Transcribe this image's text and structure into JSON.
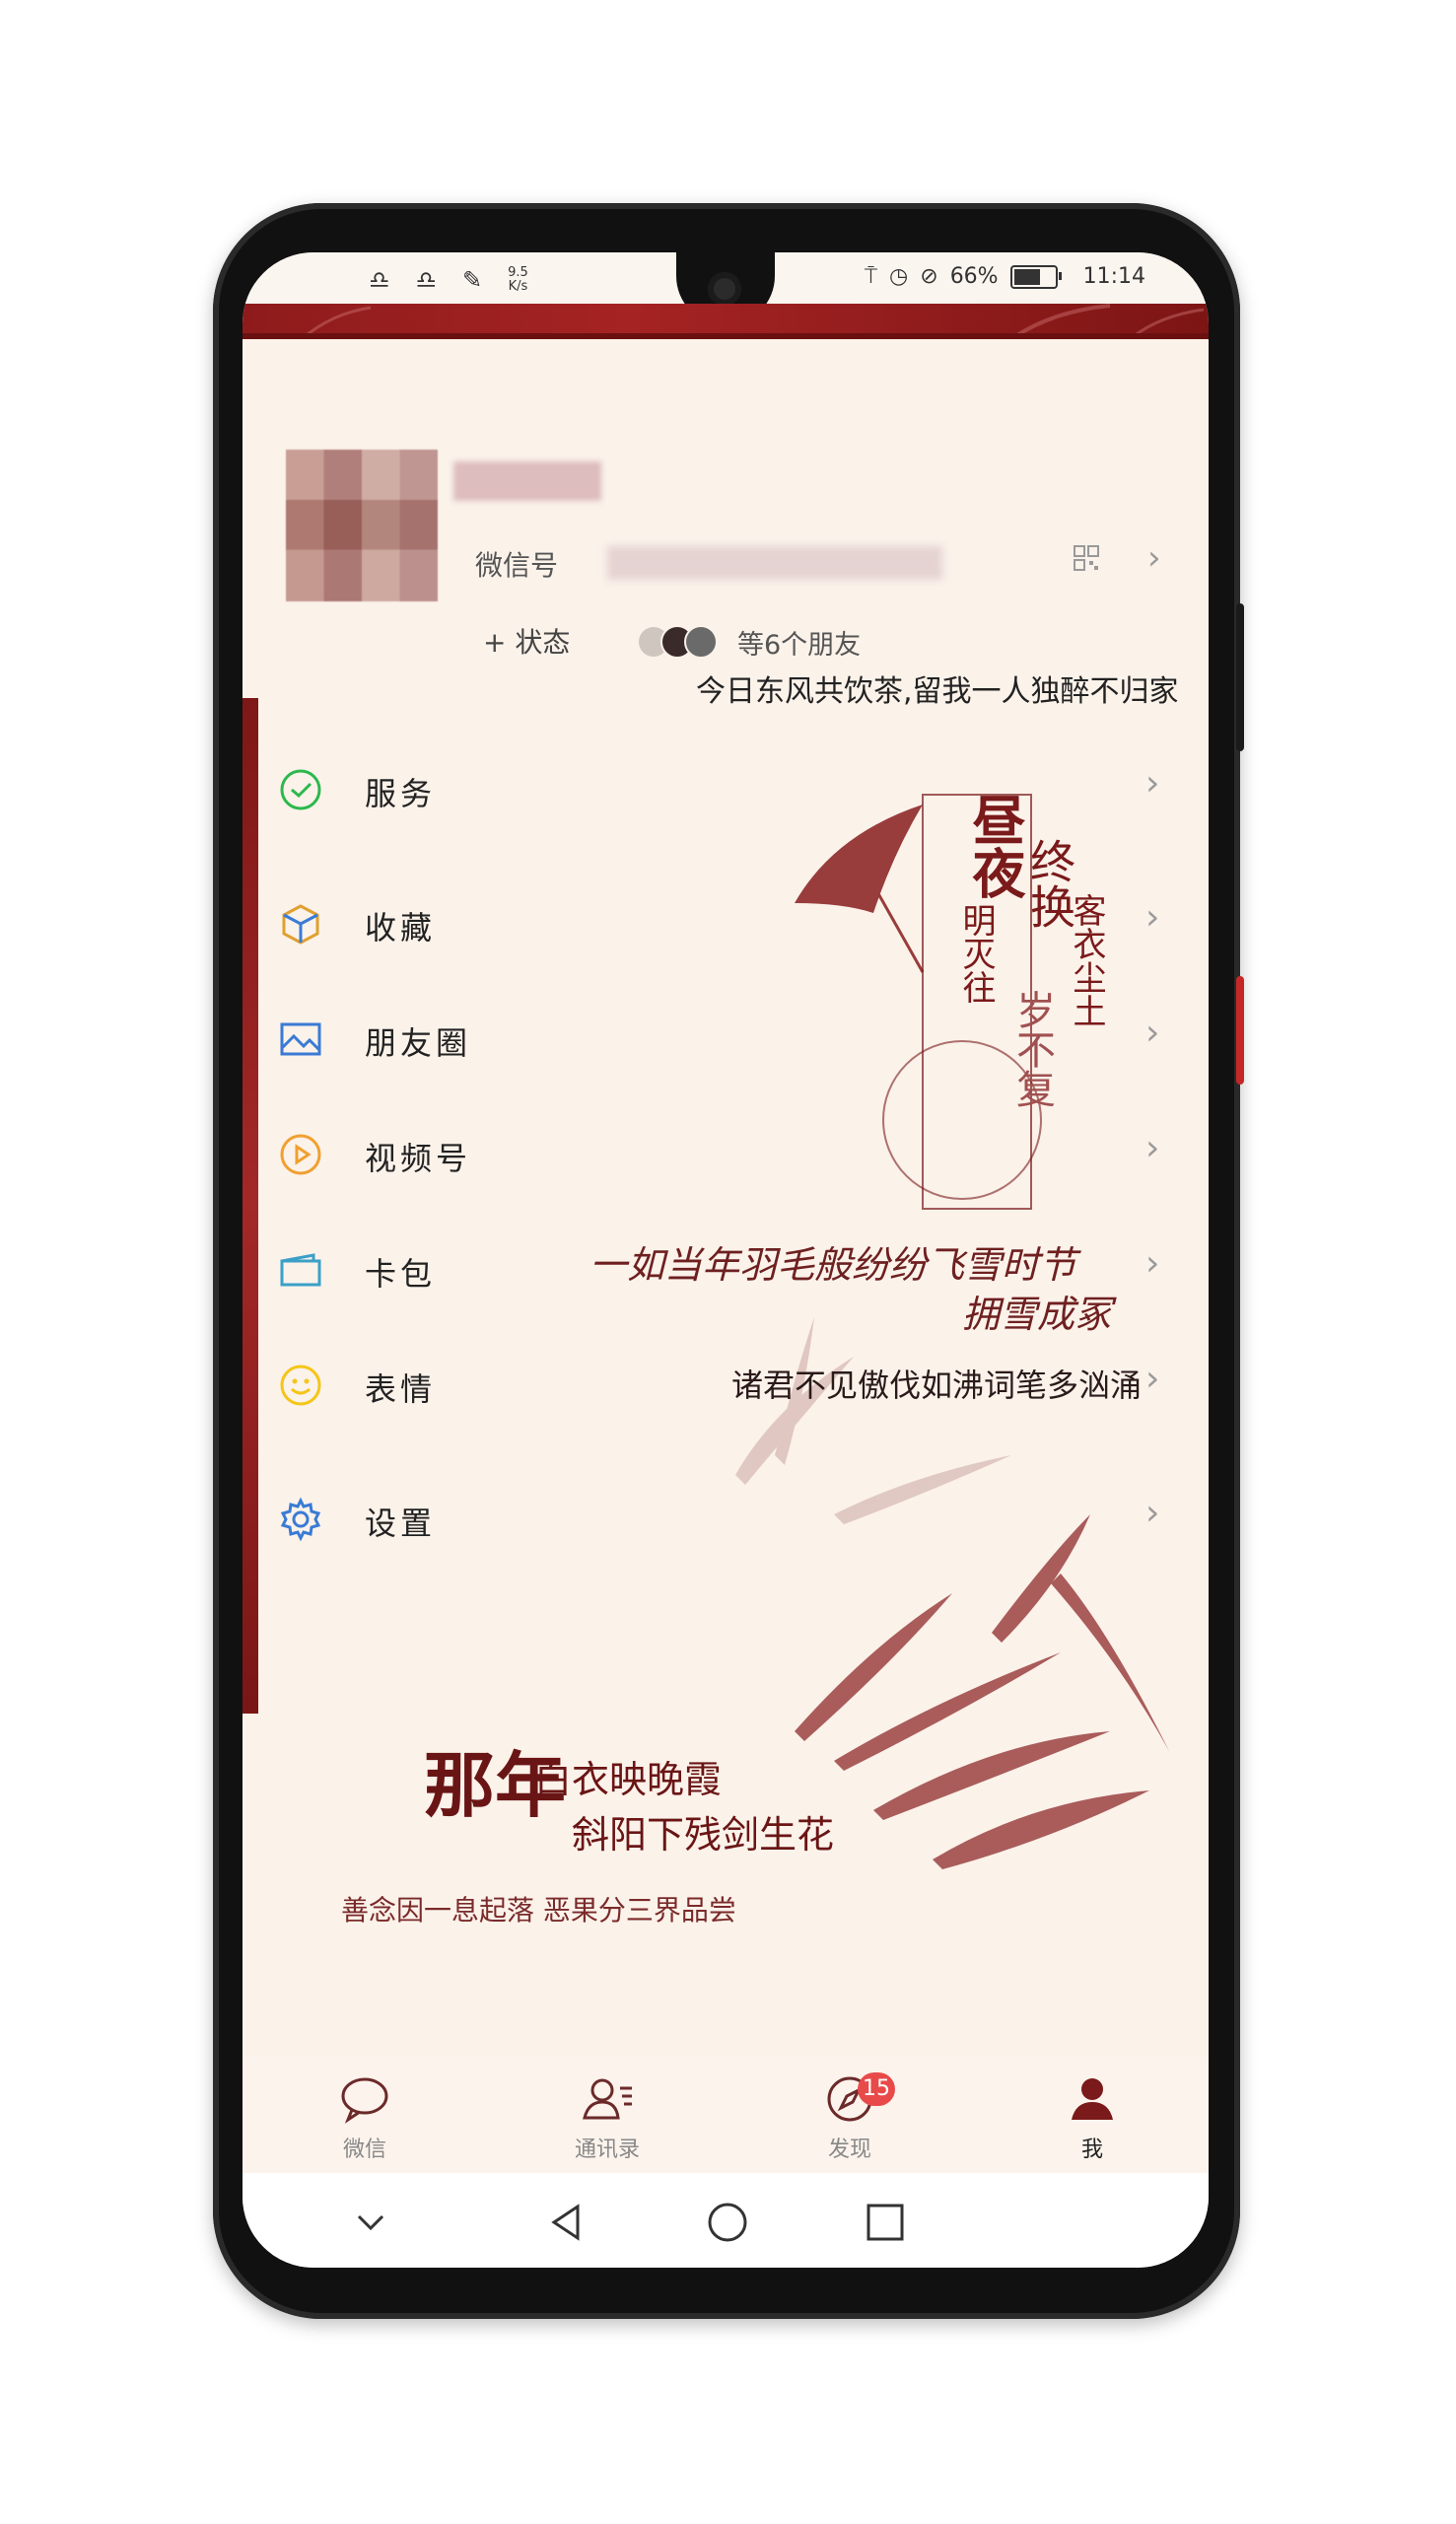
{
  "status_bar": {
    "net_speed_value": "9.5",
    "net_speed_unit": "K/s",
    "battery": "66%",
    "battery_level": 0.66,
    "time": "11:14"
  },
  "profile": {
    "wechat_id_label": "微信号",
    "status_button": "+ 状态",
    "friends_text": "等6个朋友",
    "motto": "今日东风共饮茶,留我一人独醉不归家"
  },
  "menu": {
    "items": [
      {
        "label": "服务",
        "icon": "service-icon",
        "color": "#2db84c"
      },
      {
        "label": "收藏",
        "icon": "favorites-cube-icon",
        "color": "#e0a030"
      },
      {
        "label": "朋友圈",
        "icon": "moments-picture-icon",
        "color": "#3a7bd5"
      },
      {
        "label": "视频号",
        "icon": "channels-play-icon",
        "color": "#f0a030"
      },
      {
        "label": "卡包",
        "icon": "card-wallet-icon",
        "color": "#3aa0c8"
      },
      {
        "label": "表情",
        "icon": "sticker-smile-icon",
        "color": "#f5c518"
      },
      {
        "label": "设置",
        "icon": "settings-gear-icon",
        "color": "#3a7bd5"
      }
    ]
  },
  "decor": {
    "poem_col1": "昼夜",
    "poem_col1_small": "明灭往",
    "poem_col2": "终换",
    "poem_col3": "客衣尘土",
    "poem_col4": "岁不复",
    "script_line": "一如当年羽毛般纷纷飞雪时节",
    "script_line2": "拥雪成冢",
    "poem_line": "诸君不见傲伐如沸词笔多汹涌",
    "verse_big": "那年",
    "verse_line1": "白衣映晚霞",
    "verse_line2": "斜阳下残剑生花",
    "verse_line3": "善念因一息起落  恶果分三界品尝"
  },
  "tabbar": {
    "tabs": [
      {
        "label": "微信"
      },
      {
        "label": "通讯录"
      },
      {
        "label": "发现",
        "badge": "15"
      },
      {
        "label": "我"
      }
    ]
  },
  "colors": {
    "accent_red": "#8e1b1b",
    "background": "#fbf2ea",
    "badge": "#e84a4a"
  }
}
